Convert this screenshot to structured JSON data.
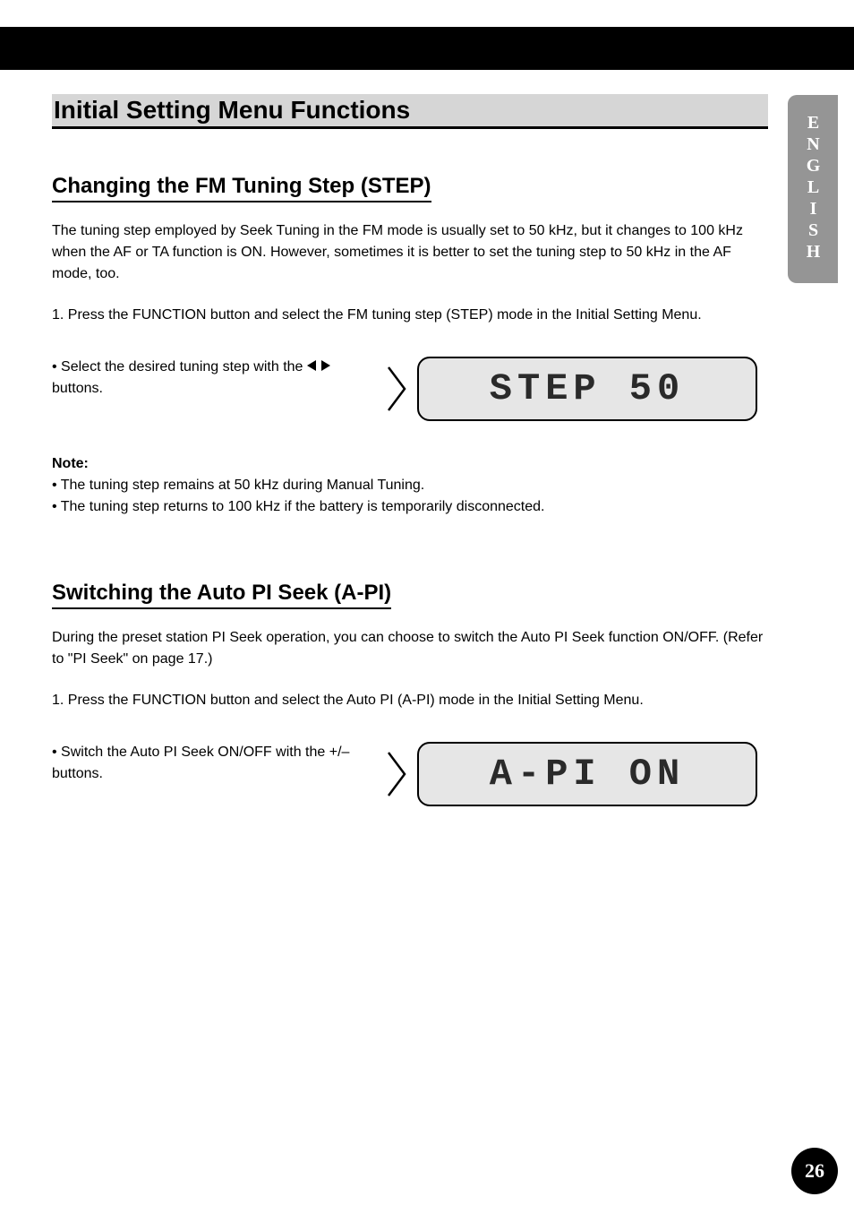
{
  "sideTab": {
    "label": "ENGLISH"
  },
  "sectionTitle": "Initial Setting Menu Functions",
  "step": {
    "heading": "Changing the FM Tuning Step (STEP)",
    "intro": "The tuning step employed by Seek Tuning in the FM mode is usually set to 50 kHz, but it changes to 100 kHz when the AF or TA function is ON. However, sometimes it is better to set the tuning step to 50 kHz in the AF mode, too.",
    "stepLabel1": "1. Press the FUNCTION button and select the FM tuning step (STEP) mode in the Initial Setting Menu.",
    "bullet": "• Select the desired tuning step with the ",
    "bulletTail": " buttons.",
    "lcd": "STEP 50",
    "noteLabel": "Note:",
    "noteLine1": "• The tuning step remains at 50 kHz during Manual Tuning.",
    "noteLine2": "• The tuning step returns to 100 kHz if the battery is temporarily disconnected."
  },
  "api": {
    "heading": "Switching the Auto PI Seek (A-PI)",
    "intro": "During the preset station PI Seek operation, you can choose to switch the Auto PI Seek function ON/OFF. (Refer to \"PI Seek\" on page 17.)",
    "stepLabel1": "1. Press the FUNCTION button and select the Auto PI (A-PI) mode in the Initial Setting Menu.",
    "bullet": "• Switch the Auto PI Seek ON/OFF with the +/– buttons.",
    "lcd": "A-PI ON"
  },
  "pageNumber": "26"
}
